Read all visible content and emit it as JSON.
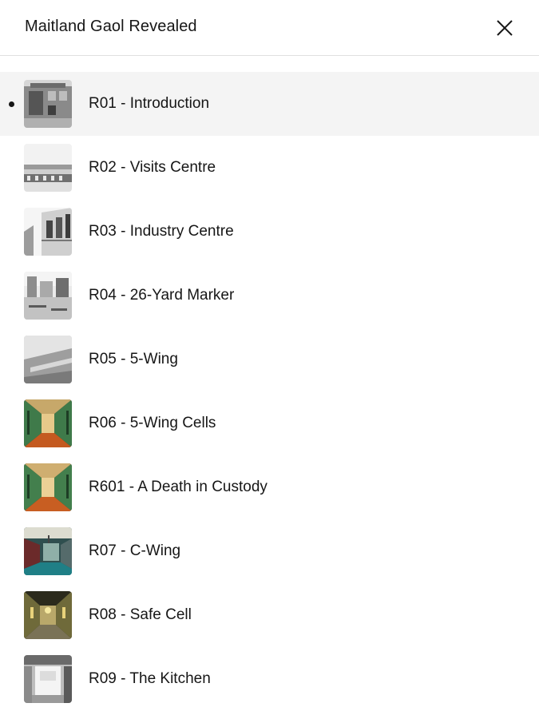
{
  "header": {
    "title": "Maitland Gaol Revealed",
    "close_icon": "close-icon"
  },
  "list": {
    "active_index": 0,
    "items": [
      {
        "label": "R01 - Introduction",
        "thumbnail": "bw-photo"
      },
      {
        "label": "R02 - Visits Centre",
        "thumbnail": "bw-photo"
      },
      {
        "label": "R03 - Industry Centre",
        "thumbnail": "bw-photo"
      },
      {
        "label": "R04 - 26-Yard Marker",
        "thumbnail": "bw-photo"
      },
      {
        "label": "R05 - 5-Wing",
        "thumbnail": "bw-photo"
      },
      {
        "label": "R06 - 5-Wing Cells",
        "thumbnail": "color-corridor"
      },
      {
        "label": "R601 - A Death in Custody",
        "thumbnail": "color-corridor"
      },
      {
        "label": "R07 - C-Wing",
        "thumbnail": "color-corridor"
      },
      {
        "label": "R08 - Safe Cell",
        "thumbnail": "color-corridor"
      },
      {
        "label": "R09 - The Kitchen",
        "thumbnail": "bw-photo"
      }
    ]
  },
  "colors": {
    "text": "#161616",
    "active_row_bg": "#f4f4f4",
    "divider": "#e0e0e0"
  }
}
